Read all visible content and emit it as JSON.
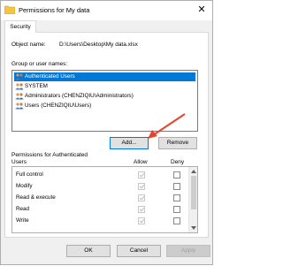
{
  "window": {
    "title": "Permissions for My data",
    "close_glyph": "✕"
  },
  "tab": {
    "label": "Security"
  },
  "object": {
    "label": "Object name:",
    "value": "D:\\Users\\Desktop\\My data.xlsx"
  },
  "groups": {
    "label": "Group or user names:",
    "items": [
      {
        "label": "Authenticated Users",
        "selected": true
      },
      {
        "label": "SYSTEM",
        "selected": false
      },
      {
        "label": "Administrators (CHENZIQIU\\Administrators)",
        "selected": false
      },
      {
        "label": "Users (CHENZIQIU\\Users)",
        "selected": false
      }
    ]
  },
  "buttons": {
    "add": "Add...",
    "remove": "Remove",
    "ok": "OK",
    "cancel": "Cancel",
    "apply": "Apply"
  },
  "permissions": {
    "header_line1": "Permissions for Authenticated",
    "header_line2": "Users",
    "allow": "Allow",
    "deny": "Deny",
    "rows": [
      "Full control",
      "Modify",
      "Read & execute",
      "Read",
      "Write"
    ]
  },
  "colors": {
    "accent": "#0078d7",
    "arrow": "#e8442b"
  }
}
